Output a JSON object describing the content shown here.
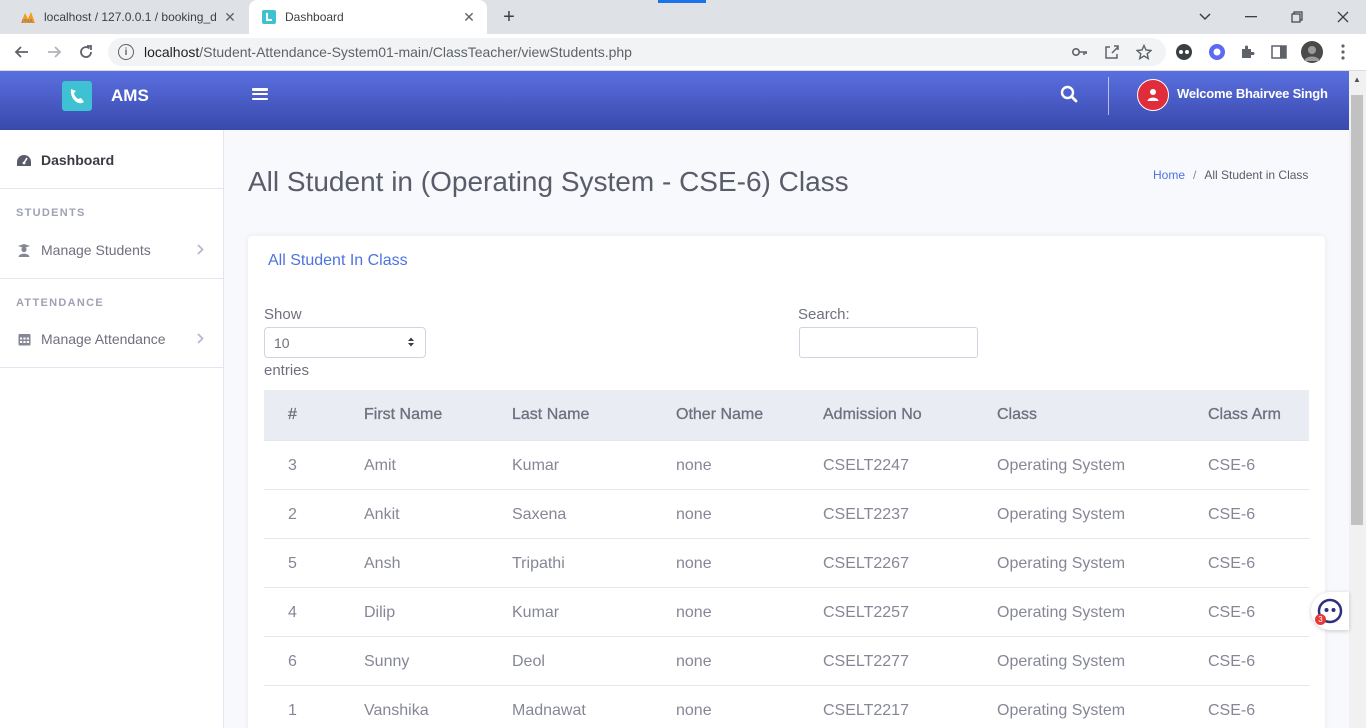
{
  "browser": {
    "tabs": [
      {
        "title": "localhost / 127.0.0.1 / booking_d"
      },
      {
        "title": "Dashboard"
      }
    ],
    "url_host": "localhost",
    "url_path": "/Student-Attendance-System01-main/ClassTeacher/viewStudents.php"
  },
  "app": {
    "brand": "AMS",
    "user_greeting": "Welcome Bhairvee Singh"
  },
  "sidebar": {
    "dashboard": "Dashboard",
    "heading_students": "STUDENTS",
    "manage_students": "Manage Students",
    "heading_attendance": "ATTENDANCE",
    "manage_attendance": "Manage Attendance"
  },
  "page": {
    "title": "All Student in (Operating System - CSE-6) Class",
    "breadcrumb": {
      "home": "Home",
      "sep": "/",
      "current": "All Student in Class"
    }
  },
  "card": {
    "title": "All Student In Class",
    "length_label": "Show",
    "length_value": "10",
    "length_suffix": "entries",
    "search_label": "Search:"
  },
  "table": {
    "headers": [
      "#",
      "First Name",
      "Last Name",
      "Other Name",
      "Admission No",
      "Class",
      "Class Arm"
    ],
    "rows": [
      [
        "3",
        "Amit",
        "Kumar",
        "none",
        "CSELT2247",
        "Operating System",
        "CSE-6"
      ],
      [
        "2",
        "Ankit",
        "Saxena",
        "none",
        "CSELT2237",
        "Operating System",
        "CSE-6"
      ],
      [
        "5",
        "Ansh",
        "Tripathi",
        "none",
        "CSELT2267",
        "Operating System",
        "CSE-6"
      ],
      [
        "4",
        "Dilip",
        "Kumar",
        "none",
        "CSELT2257",
        "Operating System",
        "CSE-6"
      ],
      [
        "6",
        "Sunny",
        "Deol",
        "none",
        "CSELT2277",
        "Operating System",
        "CSE-6"
      ],
      [
        "1",
        "Vanshika",
        "Madnawat",
        "none",
        "CSELT2217",
        "Operating System",
        "CSE-6"
      ]
    ]
  },
  "widget": {
    "badge": "3"
  }
}
